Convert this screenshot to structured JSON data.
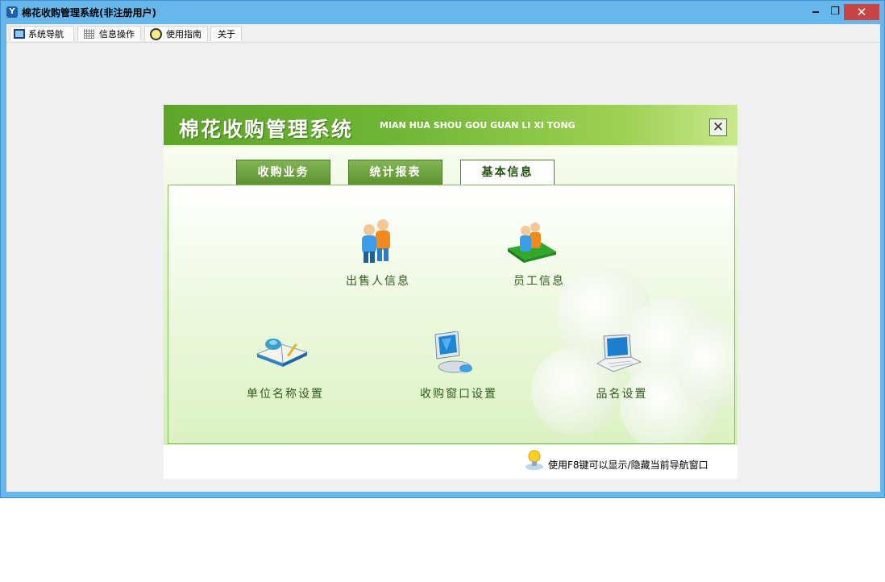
{
  "window": {
    "title": "棉花收购管理系统(非注册用户)",
    "close_glyph": "✕",
    "restore_glyph": "❐",
    "accent": "#67b6ec"
  },
  "menu": {
    "items": [
      {
        "label": "系统导航",
        "icon": "monitor-icon"
      },
      {
        "label": "信息操作",
        "icon": "grid-icon"
      },
      {
        "label": "使用指南",
        "icon": "clock-icon"
      },
      {
        "label": "关于",
        "icon": ""
      }
    ]
  },
  "nav_panel": {
    "title": "棉花收购管理系统",
    "subtitle": "MIAN HUA SHOU GOU GUAN LI XI TONG",
    "close_glyph": "✕",
    "tabs": [
      {
        "label": "收购业务",
        "active": false
      },
      {
        "label": "统计报表",
        "active": false
      },
      {
        "label": "基本信息",
        "active": true
      }
    ],
    "entries": [
      {
        "label": "出售人信息",
        "icon": "people-icon"
      },
      {
        "label": "员工信息",
        "icon": "staff-icon"
      },
      {
        "label": "单位名称设置",
        "icon": "book-icon"
      },
      {
        "label": "收购窗口设置",
        "icon": "computer-icon"
      },
      {
        "label": "品名设置",
        "icon": "laptop-icon"
      }
    ],
    "footer_hint": "使用F8键可以显示/隐藏当前导航窗口",
    "colors": {
      "header_green": "#5ea52a",
      "tab_green": "#5d922f",
      "text_green": "#2f5a1a"
    }
  }
}
